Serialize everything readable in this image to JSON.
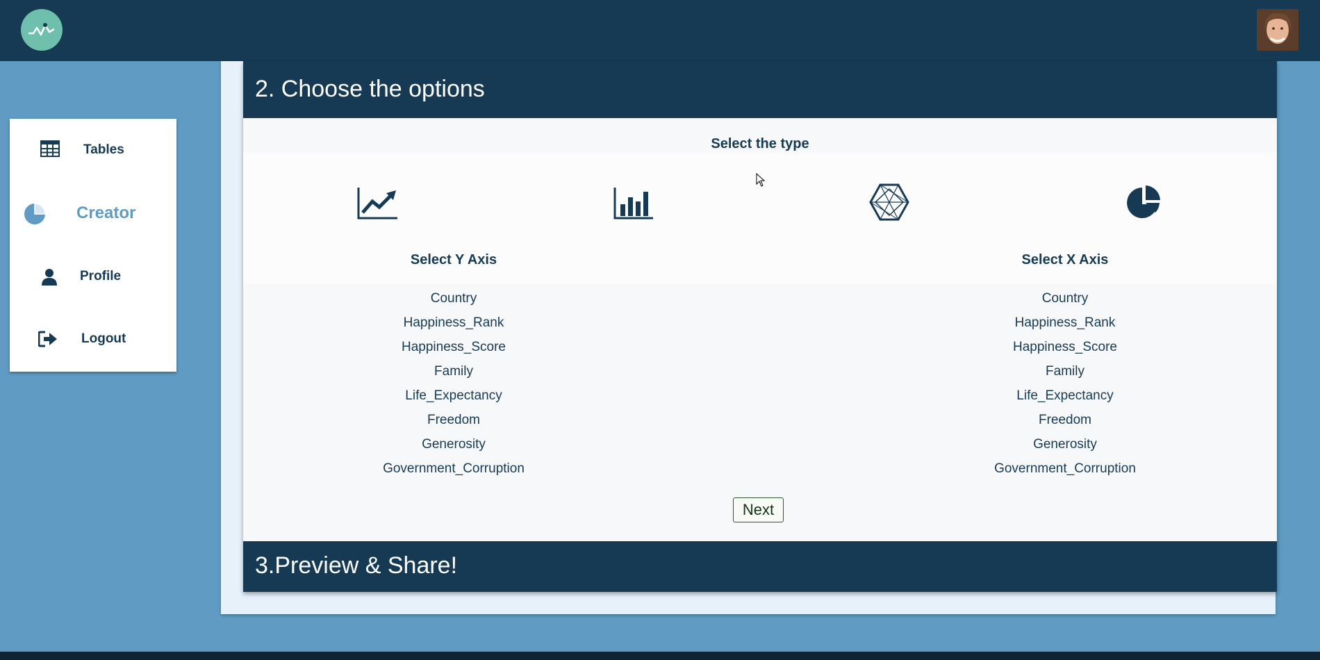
{
  "app": {
    "logo_icon": "pulse-line-icon",
    "avatar_icon": "user-avatar-photo"
  },
  "sidebar": {
    "items": [
      {
        "label": "Tables",
        "icon": "table-icon",
        "active": false
      },
      {
        "label": "Creator",
        "icon": "pie-chart-icon",
        "active": true
      },
      {
        "label": "Profile",
        "icon": "user-icon",
        "active": false
      },
      {
        "label": "Logout",
        "icon": "logout-icon",
        "active": false
      }
    ]
  },
  "step2": {
    "title": "2. Choose the options",
    "select_type_label": "Select the type",
    "chart_types": [
      {
        "icon": "line-chart-icon"
      },
      {
        "icon": "bar-chart-icon"
      },
      {
        "icon": "radar-chart-icon"
      },
      {
        "icon": "pie-chart-icon"
      }
    ],
    "y_axis": {
      "title": "Select Y Axis",
      "options": [
        "Country",
        "Happiness_Rank",
        "Happiness_Score",
        "Family",
        "Life_Expectancy",
        "Freedom",
        "Generosity",
        "Government_Corruption"
      ]
    },
    "x_axis": {
      "title": "Select X Axis",
      "options": [
        "Country",
        "Happiness_Rank",
        "Happiness_Score",
        "Family",
        "Life_Expectancy",
        "Freedom",
        "Generosity",
        "Government_Corruption"
      ]
    },
    "next_label": "Next"
  },
  "step3": {
    "title": "3.Preview & Share!"
  },
  "colors": {
    "navy": "#173a54",
    "background": "#5f9bc3",
    "accent_teal": "#6fbfad",
    "panel": "#e6f1fa"
  }
}
